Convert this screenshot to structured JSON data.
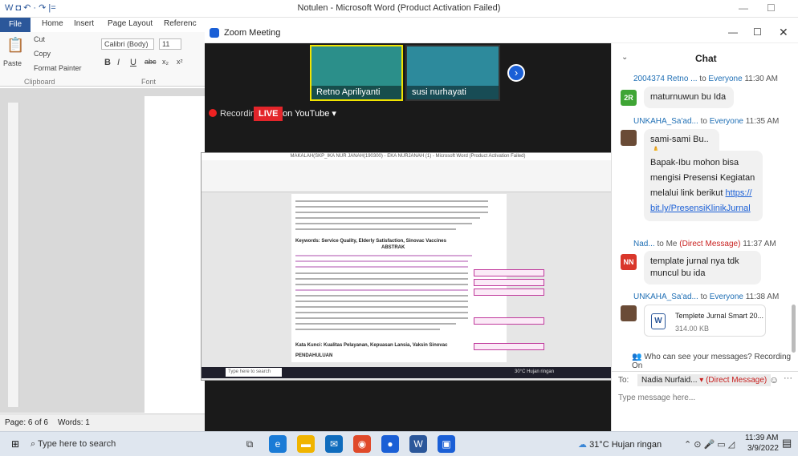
{
  "word": {
    "qat": "W ◘ ↶ · ↷ |=",
    "title": "Notulen - Microsoft Word (Product Activation Failed)",
    "file_tab": "File",
    "tabs": [
      "Home",
      "Insert",
      "Page Layout",
      "Referenc"
    ],
    "ribbon": {
      "paste": "Paste",
      "cut": "Cut",
      "copy": "Copy",
      "format_painter": "Format Painter",
      "font": "Calibri (Body)",
      "size": "11",
      "clipboard": "Clipboard",
      "font_group": "Font",
      "bold": "B",
      "italic": "I",
      "underline": "U",
      "strike": "abc",
      "sub": "x₂",
      "sup": "x²"
    },
    "status": {
      "page": "Page: 6 of 6",
      "words": "Words: 1"
    }
  },
  "zoom": {
    "title": "Zoom Meeting",
    "participants": [
      {
        "name": "Retno Apriliyanti"
      },
      {
        "name": "susi nurhayati"
      }
    ],
    "recording": "Recording",
    "live": "LIVE",
    "on": "on YouTube ▾",
    "share": {
      "doc_title": "MAKALAH(SKP_IKA NUR JANAH(190300) - EKA NURJANAH (1) - Microsoft Word (Product Activation Failed)",
      "keywords": "Keywords: Service Quality, Elderly Satisfaction, Sinovac Vaccines",
      "abstrak": "ABSTRAK",
      "kata_kunci": "Kata Kunci: Kualitas Pelayanan, Kepuasan Lansia, Vaksin Sinovac",
      "pendahuluan": "PENDAHULUAN",
      "search": "Type here to search",
      "weather": "30°C Hujan ringan"
    }
  },
  "chat": {
    "title": "Chat",
    "messages": [
      {
        "sender": "2004374 Retno ...",
        "to": "to",
        "target": "Everyone",
        "time": "11:30 AM",
        "avatar": "2R",
        "avatar_color": "#3fa535",
        "text": "maturnuwun bu Ida"
      },
      {
        "sender": "UNKAHA_Sa'ad...",
        "to": "to",
        "target": "Everyone",
        "time": "11:35 AM",
        "text": "sami-sami Bu..🙏"
      },
      {
        "text_pre": "Bapak-Ibu mohon bisa mengisi Presensi Kegiatan melalui link berikut",
        "link": "https://bit.ly/PresensiKlinikJurnal"
      },
      {
        "sender": "Nad...",
        "to": "to Me",
        "target": "(Direct Message)",
        "time": "11:37 AM",
        "avatar": "NN",
        "avatar_color": "#d9372b",
        "text": "template jurnal nya tdk muncul bu ida"
      },
      {
        "sender": "UNKAHA_Sa'ad...",
        "to": "to",
        "target": "Everyone",
        "time": "11:38 AM",
        "file_name": "Templete Jurnal Smart 20...",
        "file_size": "314.00 KB"
      }
    ],
    "who_can_see": "Who can see your messages? Recording On",
    "to_label": "To:",
    "to_value": "Nadia Nurfaid...",
    "to_dm": "(Direct Message)",
    "placeholder": "Type message here..."
  },
  "taskbar": {
    "search": "Type here to search",
    "weather": "31°C Hujan ringan",
    "time": "11:39 AM",
    "date": "3/9/2022"
  }
}
